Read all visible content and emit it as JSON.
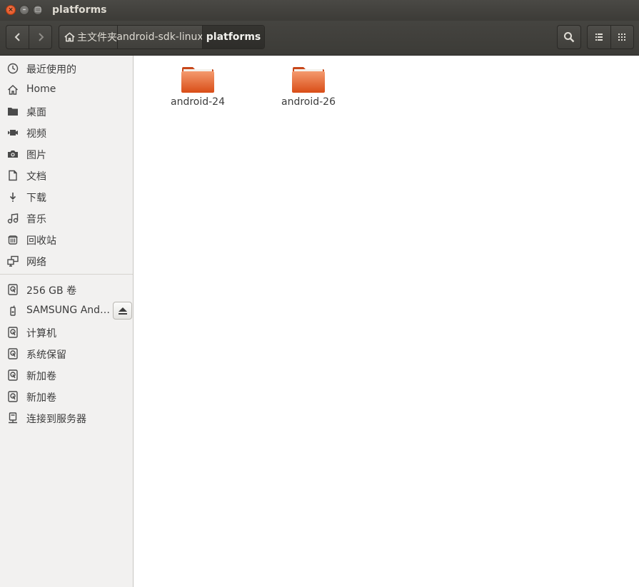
{
  "window": {
    "title": "platforms",
    "buttons": {
      "close": "×",
      "minimize": "–",
      "maximize": "□"
    }
  },
  "toolbar": {
    "back": "‹",
    "forward": "›",
    "breadcrumbs": [
      "主文件夹",
      "android-sdk-linux",
      "platforms"
    ]
  },
  "sidebar": {
    "places": [
      {
        "label": "最近使用的",
        "icon": "clock-icon"
      },
      {
        "label": "Home",
        "icon": "home-icon"
      },
      {
        "label": "桌面",
        "icon": "folder-icon"
      },
      {
        "label": "视频",
        "icon": "video-icon"
      },
      {
        "label": "图片",
        "icon": "camera-icon"
      },
      {
        "label": "文档",
        "icon": "document-icon"
      },
      {
        "label": "下载",
        "icon": "download-icon"
      },
      {
        "label": "音乐",
        "icon": "music-icon"
      },
      {
        "label": "回收站",
        "icon": "trash-icon"
      },
      {
        "label": "网络",
        "icon": "network-icon"
      }
    ],
    "devices": [
      {
        "label": "256 GB 卷",
        "icon": "drive-icon"
      },
      {
        "label": "SAMSUNG And…",
        "icon": "phone-icon"
      },
      {
        "label": "计算机",
        "icon": "drive-icon"
      },
      {
        "label": "系统保留",
        "icon": "drive-icon"
      },
      {
        "label": "新加卷",
        "icon": "drive-icon"
      },
      {
        "label": "新加卷",
        "icon": "drive-icon"
      },
      {
        "label": "连接到服务器",
        "icon": "server-icon"
      }
    ]
  },
  "content": {
    "folders": [
      {
        "name": "android-24"
      },
      {
        "name": "android-26"
      }
    ]
  },
  "colors": {
    "folder_orange": "#e8622e",
    "titlebar": "#3c3b37",
    "close_button": "#df4a16"
  }
}
